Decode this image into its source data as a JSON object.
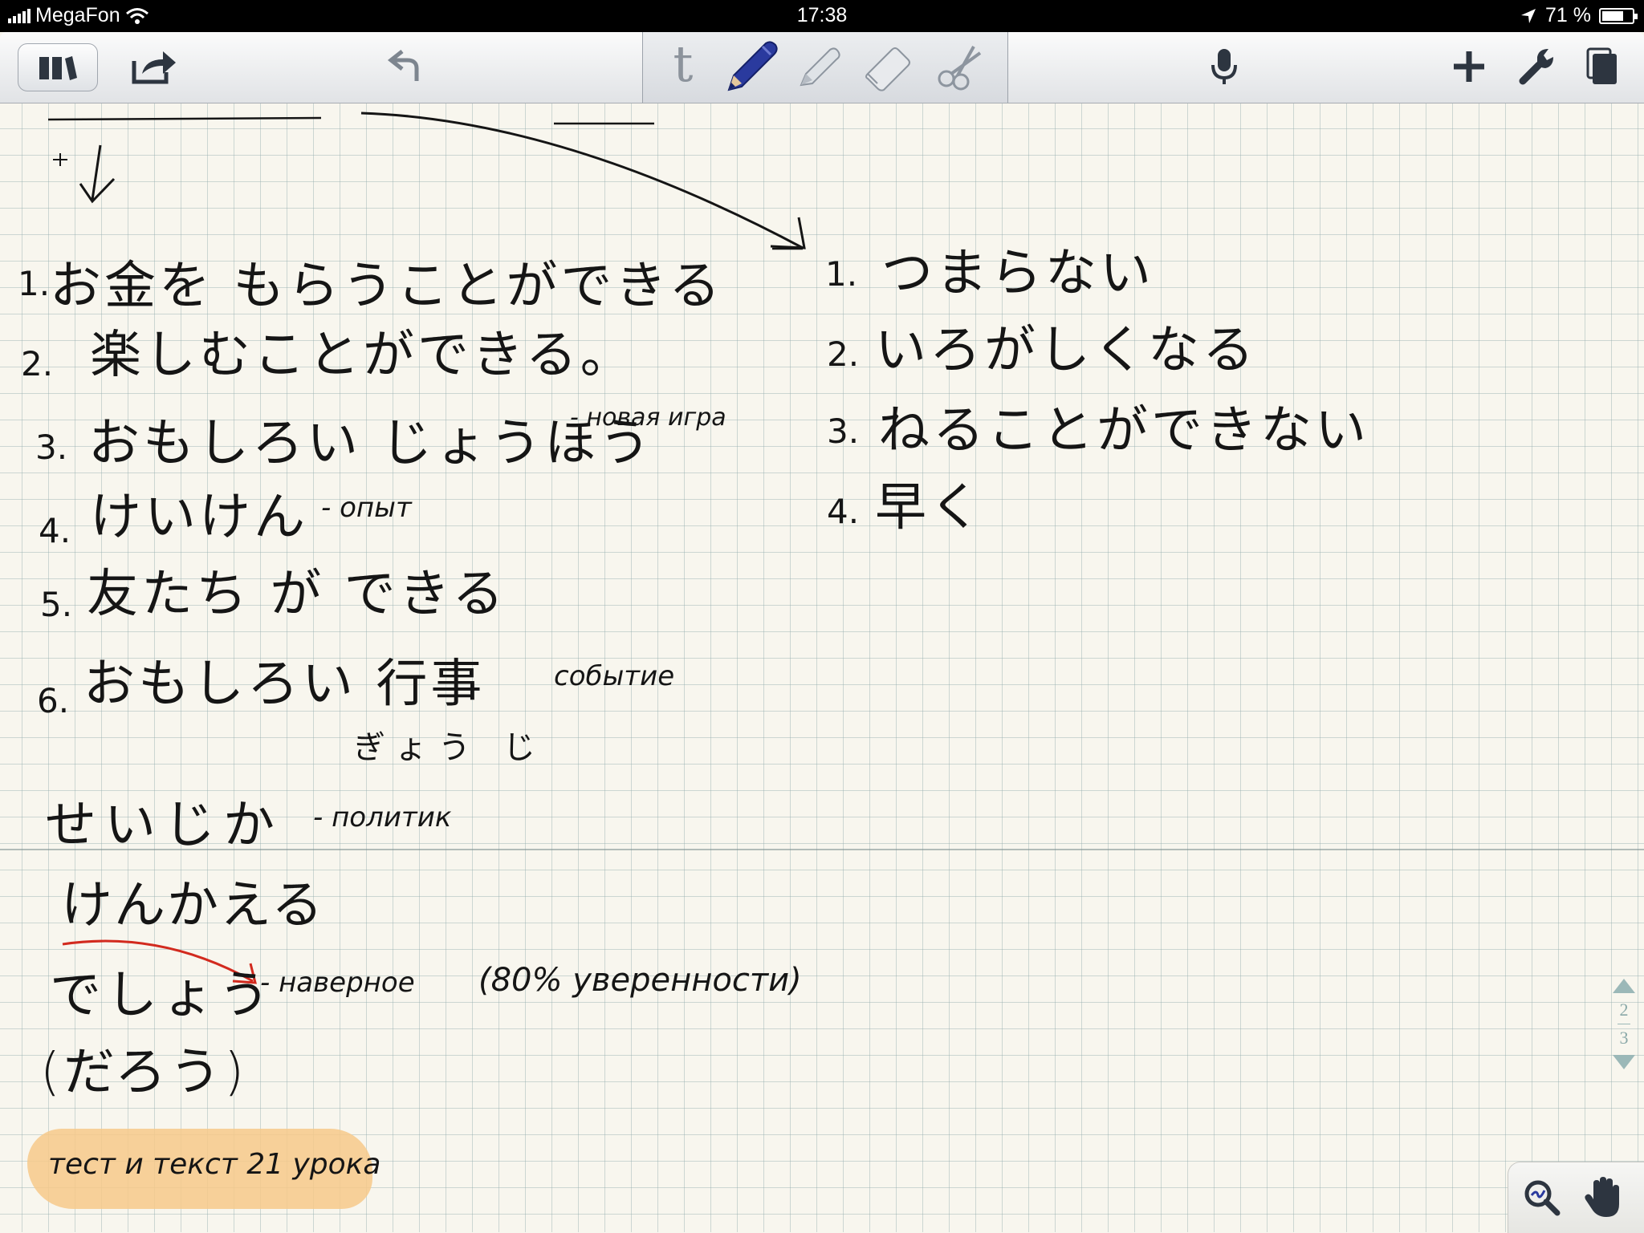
{
  "status_bar": {
    "carrier": "MegaFon",
    "time": "17:38",
    "battery": "71 %",
    "battery_level": 0.71
  },
  "toolbar": {
    "left": [
      {
        "name": "library",
        "icon": "library-icon"
      },
      {
        "name": "share",
        "icon": "share-icon"
      },
      {
        "name": "undo",
        "icon": "undo-icon"
      }
    ],
    "tools": [
      {
        "name": "text-tool",
        "icon": "text-tool-icon",
        "label": "t"
      },
      {
        "name": "pen-tool",
        "icon": "pen-icon",
        "selected": true
      },
      {
        "name": "highlighter-tool",
        "icon": "highlighter-icon"
      },
      {
        "name": "eraser-tool",
        "icon": "eraser-icon"
      },
      {
        "name": "scissors-tool",
        "icon": "scissors-icon"
      }
    ],
    "right": [
      {
        "name": "microphone",
        "icon": "microphone-icon"
      },
      {
        "name": "add-page",
        "icon": "plus-icon"
      },
      {
        "name": "settings",
        "icon": "wrench-icon"
      },
      {
        "name": "pages",
        "icon": "pages-icon"
      }
    ],
    "pen_color": "#1d2a8c"
  },
  "notes": {
    "left_list": [
      {
        "num": "1.",
        "text": "お金を もらうことができる"
      },
      {
        "num": "2.",
        "text": "楽しむことができる。"
      },
      {
        "num": "3.",
        "text": "おもしろい じょうほう",
        "gloss": "- новая игра"
      },
      {
        "num": "4.",
        "text": "けいけん",
        "gloss": "- опыт"
      },
      {
        "num": "5.",
        "text": "友たち が できる"
      },
      {
        "num": "6.",
        "text": "おもしろい 行事",
        "gloss": "событие",
        "reading": "ぎょう じ"
      }
    ],
    "right_list": [
      {
        "num": "1.",
        "text": "つまらない"
      },
      {
        "num": "2.",
        "text": "いろがしくなる"
      },
      {
        "num": "3.",
        "text": "ねることができない"
      },
      {
        "num": "4.",
        "text": "早く"
      }
    ],
    "seijika": {
      "text": "せいじか",
      "gloss": "- политик"
    },
    "kenkaeru": "けんかえる",
    "deshou": {
      "text": "でしょう",
      "gloss": "- наверное",
      "paren": "(80% уверенности)"
    },
    "darou": "(だろう)",
    "highlighted_note": "тест и текст 21 урока"
  },
  "page_nav": {
    "current": "2",
    "total": "3"
  },
  "colors": {
    "paper": "#f8f6ee",
    "grid": "#a9c0c0",
    "highlight": "#f7c98a",
    "red_ink": "#d22a1e"
  }
}
